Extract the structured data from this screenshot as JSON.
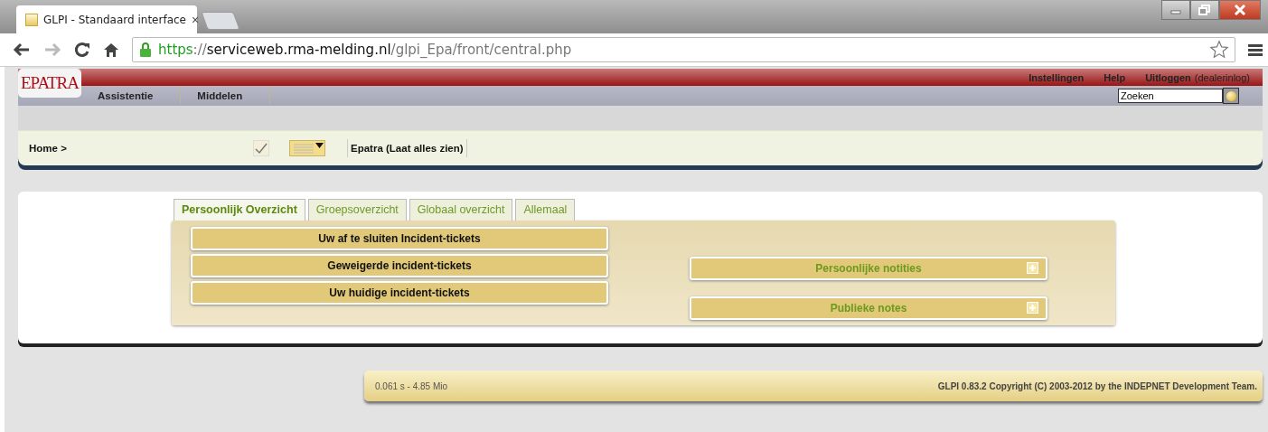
{
  "browser": {
    "tab_title": "GLPI - Standaard interface",
    "tab_close": "×",
    "url": {
      "scheme": "https",
      "separator": "://",
      "host": "serviceweb.rma-melding.nl",
      "path": "/glpi_Epa/front/central.php"
    }
  },
  "header": {
    "logo": "EPATRA",
    "top_links": [
      {
        "label": "Instellingen"
      },
      {
        "label": "Help"
      },
      {
        "label": "Uitloggen",
        "note": "(dealerinlog)"
      }
    ],
    "menu": [
      {
        "label": "Assistentie"
      },
      {
        "label": "Middelen"
      }
    ],
    "search": {
      "value": "Zoeken"
    },
    "breadcrumb": "Home >",
    "entity": "Epatra (Laat alles zien)"
  },
  "tabs": [
    {
      "label": "Persoonlijk Overzicht",
      "selected": true
    },
    {
      "label": "Groepsoverzicht",
      "selected": false
    },
    {
      "label": "Globaal overzicht",
      "selected": false
    },
    {
      "label": "Allemaal",
      "selected": false
    }
  ],
  "left_panels": [
    {
      "label": "Uw af te sluiten Incident-tickets"
    },
    {
      "label": "Geweigerde incident-tickets"
    },
    {
      "label": "Uw huidige incident-tickets"
    }
  ],
  "right_panels": [
    {
      "label": "Persoonlijke notities"
    },
    {
      "label": "Publieke notes"
    }
  ],
  "footer": {
    "timing": "0.061 s - 4.85 Mio",
    "copyright": "GLPI 0.83.2 Copyright (C) 2003-2012 by the INDEPNET Development Team."
  }
}
